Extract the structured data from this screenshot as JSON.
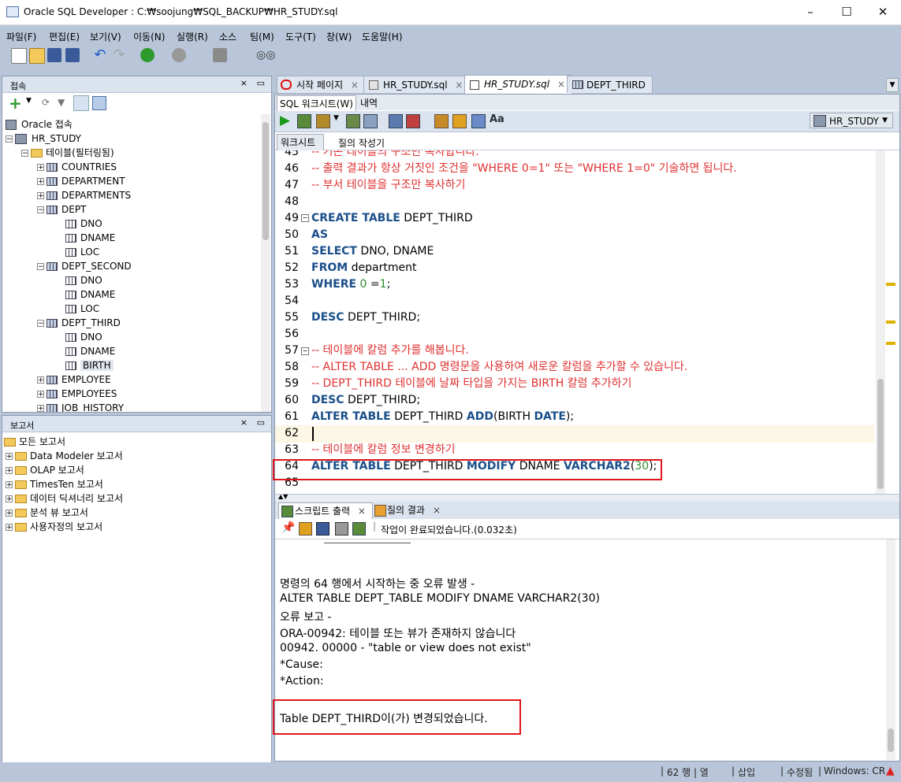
{
  "window": {
    "title": "Oracle SQL Developer : C:₩soojung₩SQL_BACKUP₩HR_STUDY.sql",
    "min": "–",
    "max": "☐",
    "close": "✕"
  },
  "menu": [
    "파일(F)",
    "편집(E)",
    "보기(V)",
    "이동(N)",
    "실행(R)",
    "소스",
    "팀(M)",
    "도구(T)",
    "창(W)",
    "도움말(H)"
  ],
  "connections": {
    "title": "접속",
    "root": "Oracle 접속",
    "connection": "HR_STUDY",
    "tables_folder": "테이블(필터링됨)",
    "items": [
      {
        "label": "COUNTRIES",
        "type": "table",
        "expanded": false
      },
      {
        "label": "DEPARTMENT",
        "type": "table",
        "expanded": false
      },
      {
        "label": "DEPARTMENTS",
        "type": "table",
        "expanded": false
      },
      {
        "label": "DEPT",
        "type": "table",
        "expanded": true
      },
      {
        "label": "DNO",
        "type": "column"
      },
      {
        "label": "DNAME",
        "type": "column"
      },
      {
        "label": "LOC",
        "type": "column"
      },
      {
        "label": "DEPT_SECOND",
        "type": "table",
        "expanded": true
      },
      {
        "label": "DNO",
        "type": "column"
      },
      {
        "label": "DNAME",
        "type": "column"
      },
      {
        "label": "LOC",
        "type": "column"
      },
      {
        "label": "DEPT_THIRD",
        "type": "table",
        "expanded": true
      },
      {
        "label": "DNO",
        "type": "column"
      },
      {
        "label": "DNAME",
        "type": "column"
      },
      {
        "label": "BIRTH",
        "type": "column",
        "selected": true
      },
      {
        "label": "EMPLOYEE",
        "type": "table",
        "expanded": false
      },
      {
        "label": "EMPLOYEES",
        "type": "table",
        "expanded": false
      },
      {
        "label": "JOB_HISTORY",
        "type": "table",
        "expanded": false
      }
    ]
  },
  "reports": {
    "title": "보고서",
    "root": "모든 보고서",
    "items": [
      "Data Modeler 보고서",
      "OLAP 보고서",
      "TimesTen 보고서",
      "데이터 딕셔너리 보고서",
      "분석 뷰 보고서",
      "사용자정의 보고서"
    ]
  },
  "tabs": [
    {
      "label": "시작 페이지",
      "active": false
    },
    {
      "label": "HR_STUDY.sql",
      "active": false
    },
    {
      "label": "HR_STUDY.sql",
      "active": true
    },
    {
      "label": "DEPT_THIRD",
      "active": false
    }
  ],
  "worksheet": {
    "subtabs": [
      "SQL 워크시트(W)",
      "내역"
    ],
    "connection_selector": "HR_STUDY",
    "editor_tabs": [
      "워크시트",
      "질의 작성기"
    ]
  },
  "code_lines": [
    {
      "n": "45",
      "html": "<span class='cm'>-- 기존 테이블의 구조만 복사합니다.</span>"
    },
    {
      "n": "46",
      "html": "<span class='cm'>-- 출력 결과가 항상 거짓인 조건을 \"WHERE 0=1\" 또는 \"WHERE 1=0\" 기술하면 됩니다.</span>"
    },
    {
      "n": "47",
      "html": "<span class='cm'>-- 부서 테이블을 구조만 복사하기</span>"
    },
    {
      "n": "48",
      "html": ""
    },
    {
      "n": "49",
      "html": "<span class='kw'>CREATE TABLE</span> DEPT_THIRD"
    },
    {
      "n": "50",
      "html": "<span class='kw'>AS</span>"
    },
    {
      "n": "51",
      "html": "<span class='kw'>SELECT</span> DNO, DNAME"
    },
    {
      "n": "52",
      "html": "<span class='kw'>FROM</span> department"
    },
    {
      "n": "53",
      "html": "<span class='kw'>WHERE</span> <span class='num'>0</span> =<span class='num'>1</span>;"
    },
    {
      "n": "54",
      "html": ""
    },
    {
      "n": "55",
      "html": "<span class='kw'>DESC</span> DEPT_THIRD;"
    },
    {
      "n": "56",
      "html": ""
    },
    {
      "n": "57",
      "html": "<span class='cm'>-- 테이블에 칼럼 추가를 해봅니다.</span>"
    },
    {
      "n": "58",
      "html": "<span class='cm'>-- ALTER TABLE ... ADD 명령문을 사용하여 새로운 칼럼을 추가할 수 있습니다.</span>"
    },
    {
      "n": "59",
      "html": "<span class='cm'>-- DEPT_THIRD 테이블에 날짜 타입을 가지는 BIRTH 칼럼 추가하기</span>"
    },
    {
      "n": "60",
      "html": "<span class='kw'>DESC</span> DEPT_THIRD;"
    },
    {
      "n": "61",
      "html": "<span class='kw'>ALTER TABLE</span> DEPT_THIRD <span class='kw'>ADD</span>(BIRTH <span class='kw'>DATE</span>);"
    },
    {
      "n": "62",
      "html": ""
    },
    {
      "n": "63",
      "html": "<span class='cm'>-- 테이블에 칼럼 정보 변경하기</span>"
    },
    {
      "n": "64",
      "html": "<span class='kw'>ALTER TABLE</span> DEPT_THIRD <span class='kw'>MODIFY</span> DNAME <span class='kw'>VARCHAR2</span>(<span class='num'>30</span>);"
    },
    {
      "n": "65",
      "html": ""
    }
  ],
  "output": {
    "tabs": [
      "스크립트 출력",
      "질의 결과"
    ],
    "status": "작업이 완료되었습니다.(0.032초)",
    "lines": [
      "명령의 64 행에서 시작하는 중 오류 발생 -",
      "ALTER TABLE DEPT_TABLE MODIFY DNAME VARCHAR2(30)",
      "오류 보고 -",
      "ORA-00942: 테이블 또는 뷰가 존재하지 않습니다",
      "00942. 00000 -  \"table or view does not exist\"",
      "*Cause:",
      "*Action:"
    ],
    "result": "Table DEPT_THIRD이(가) 변경되었습니다."
  },
  "statusbar": {
    "position": "62 행 | 열",
    "insert": "삽입",
    "modified": "수정됨",
    "platform": "Windows: CR"
  },
  "colors": {
    "highlight_box": "#e0151b",
    "keyword": "#1b4f8a",
    "comment": "#e03030"
  }
}
